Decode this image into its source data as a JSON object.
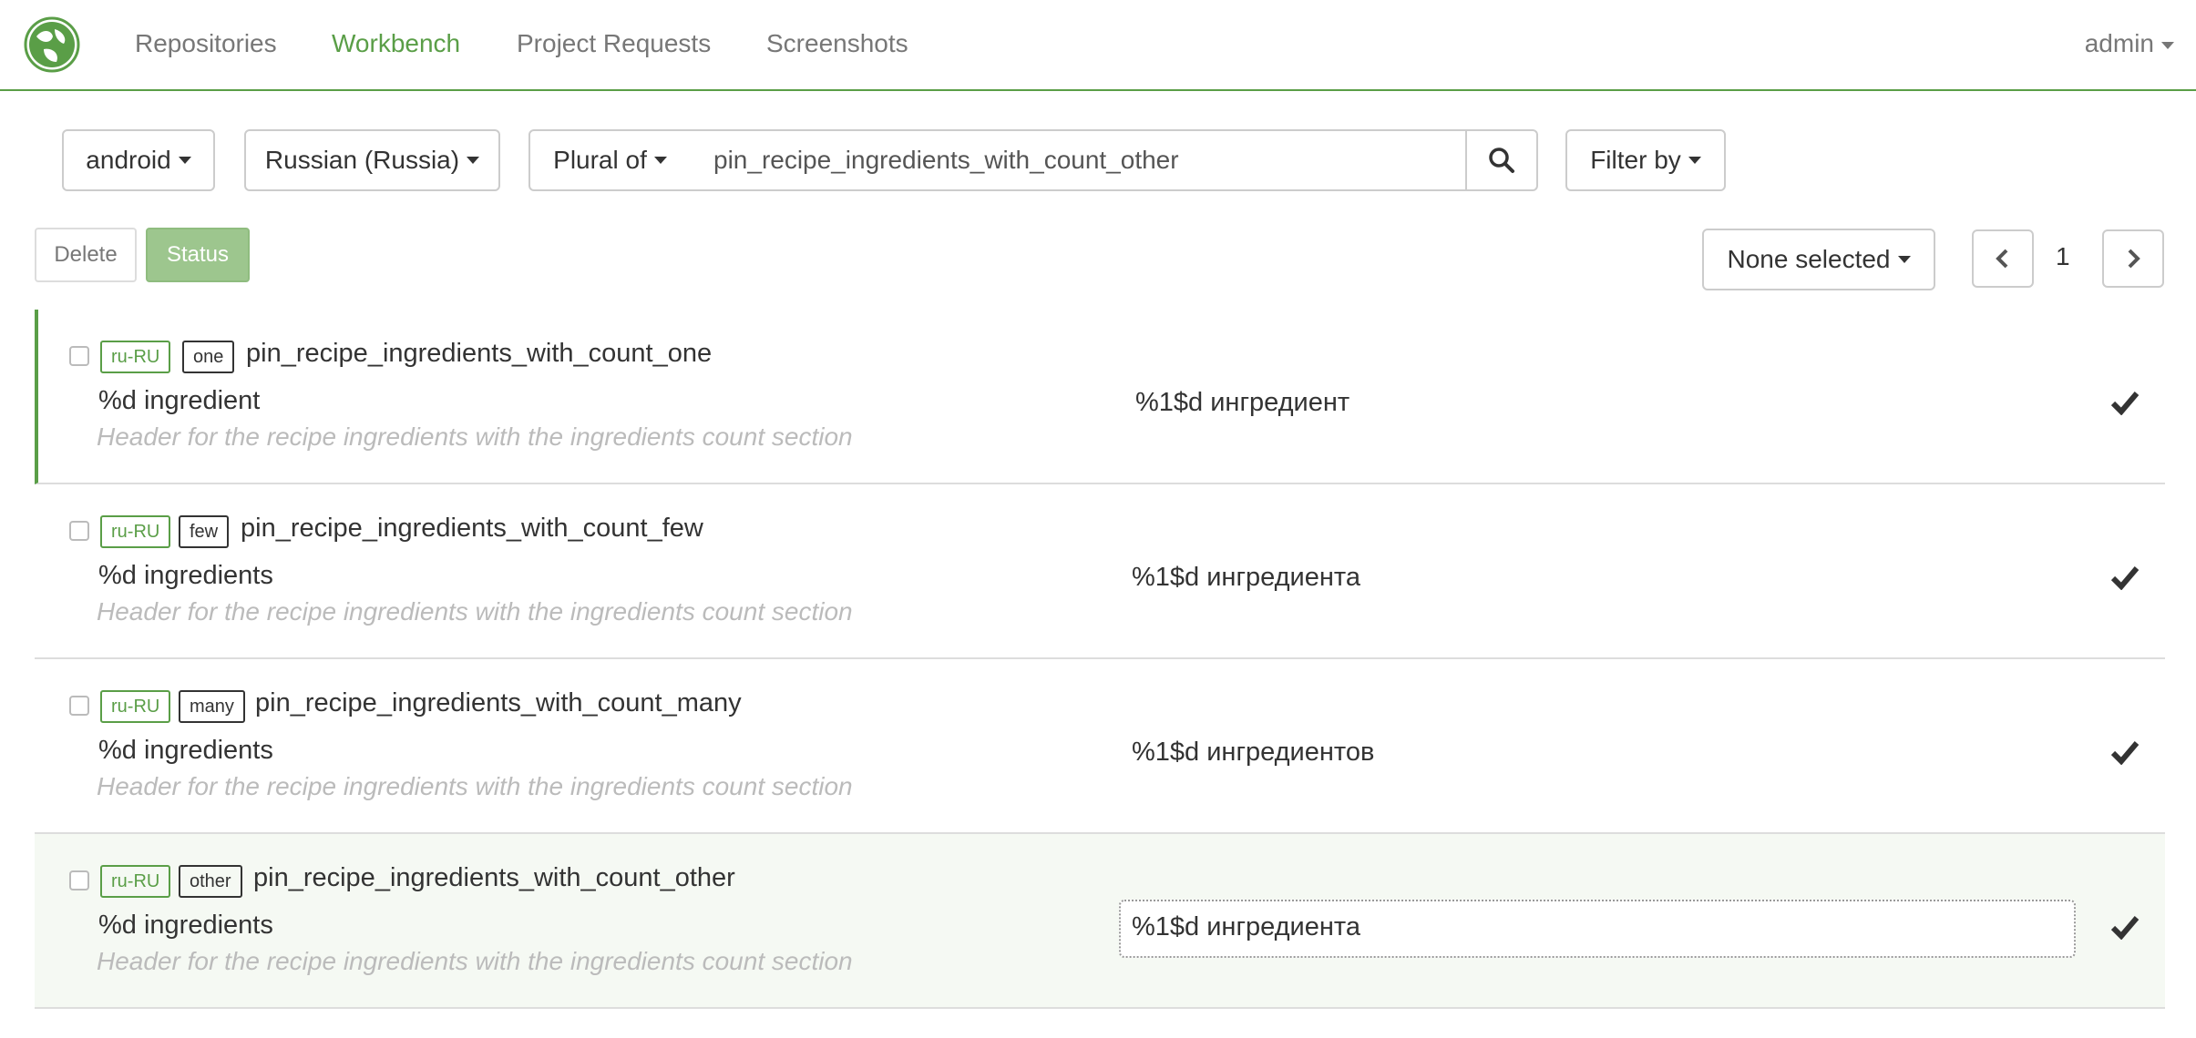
{
  "nav": {
    "links": [
      {
        "label": "Repositories"
      },
      {
        "label": "Workbench"
      },
      {
        "label": "Project Requests"
      },
      {
        "label": "Screenshots"
      }
    ],
    "user": "admin"
  },
  "toolbar": {
    "repo": "android",
    "locale": "Russian (Russia)",
    "search_type": "Plural of",
    "search_value": "pin_recipe_ingredients_with_count_other",
    "filter_label": "Filter by"
  },
  "actions": {
    "delete_label": "Delete",
    "status_label": "Status",
    "selection_label": "None selected",
    "page": "1"
  },
  "colors": {
    "accent": "#5a9e47",
    "status_button": "#9dc68e"
  },
  "rows": [
    {
      "locale": "ru-RU",
      "plural": "one",
      "text_id": "pin_recipe_ingredients_with_count_one",
      "source": "%d ingredient",
      "comment": "Header for the recipe ingredients with the ingredients count section",
      "target": "%1$d ингредиент"
    },
    {
      "locale": "ru-RU",
      "plural": "few",
      "text_id": "pin_recipe_ingredients_with_count_few",
      "source": "%d ingredients",
      "comment": "Header for the recipe ingredients with the ingredients count section",
      "target": "%1$d ингредиента"
    },
    {
      "locale": "ru-RU",
      "plural": "many",
      "text_id": "pin_recipe_ingredients_with_count_many",
      "source": "%d ingredients",
      "comment": "Header for the recipe ingredients with the ingredients count section",
      "target": "%1$d ингредиентов"
    },
    {
      "locale": "ru-RU",
      "plural": "other",
      "text_id": "pin_recipe_ingredients_with_count_other",
      "source": "%d ingredients",
      "comment": "Header for the recipe ingredients with the ingredients count section",
      "target": "%1$d ингредиента"
    }
  ]
}
